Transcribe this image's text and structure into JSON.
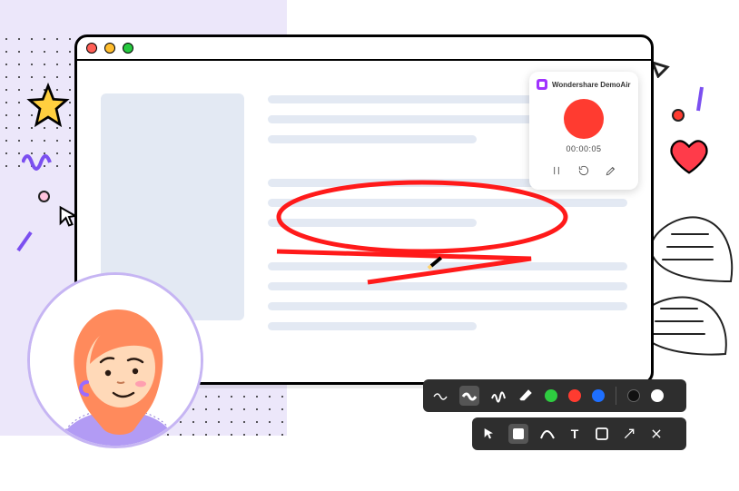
{
  "brand": {
    "name": "Wondershare DemoAir"
  },
  "recorder": {
    "timer": "00:00:05"
  },
  "toolbar_brush": {
    "items": [
      "wave-thin",
      "wave-bold",
      "wave-scribble",
      "eraser"
    ],
    "colors": [
      "green",
      "red",
      "blue",
      "black",
      "white"
    ]
  },
  "toolbar_tools": {
    "items": [
      "pointer",
      "shape-filled",
      "draw",
      "text",
      "shape-outline",
      "arrow",
      "close"
    ]
  },
  "icons": {
    "pause": "pause",
    "restart": "restart",
    "edit": "edit"
  }
}
